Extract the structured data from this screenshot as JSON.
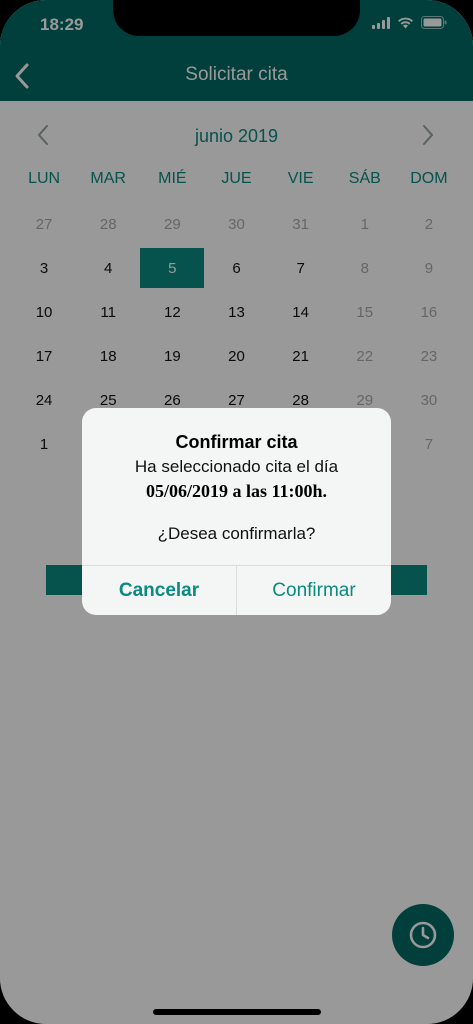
{
  "status_bar": {
    "time": "18:29"
  },
  "header": {
    "title": "Solicitar cita"
  },
  "calendar": {
    "month_label": "junio 2019",
    "weekdays": [
      "LUN",
      "MAR",
      "MIÉ",
      "JUE",
      "VIE",
      "SÁB",
      "DOM"
    ],
    "days": [
      {
        "n": "27",
        "muted": true
      },
      {
        "n": "28",
        "muted": true
      },
      {
        "n": "29",
        "muted": true
      },
      {
        "n": "30",
        "muted": true
      },
      {
        "n": "31",
        "muted": true
      },
      {
        "n": "1",
        "muted": true
      },
      {
        "n": "2",
        "muted": true
      },
      {
        "n": "3"
      },
      {
        "n": "4"
      },
      {
        "n": "5",
        "selected": true
      },
      {
        "n": "6"
      },
      {
        "n": "7"
      },
      {
        "n": "8",
        "muted": true
      },
      {
        "n": "9",
        "muted": true
      },
      {
        "n": "10"
      },
      {
        "n": "11"
      },
      {
        "n": "12"
      },
      {
        "n": "13"
      },
      {
        "n": "14"
      },
      {
        "n": "15",
        "muted": true
      },
      {
        "n": "16",
        "muted": true
      },
      {
        "n": "17"
      },
      {
        "n": "18"
      },
      {
        "n": "19"
      },
      {
        "n": "20"
      },
      {
        "n": "21"
      },
      {
        "n": "22",
        "muted": true
      },
      {
        "n": "23",
        "muted": true
      },
      {
        "n": "24"
      },
      {
        "n": "25"
      },
      {
        "n": "26"
      },
      {
        "n": "27"
      },
      {
        "n": "28"
      },
      {
        "n": "29",
        "muted": true
      },
      {
        "n": "30",
        "muted": true
      },
      {
        "n": "1"
      },
      {
        "n": ""
      },
      {
        "n": ""
      },
      {
        "n": ""
      },
      {
        "n": ""
      },
      {
        "n": ""
      },
      {
        "n": "7",
        "muted": true
      }
    ]
  },
  "dialog": {
    "title": "Confirmar cita",
    "line1": "Ha seleccionado cita el día",
    "line2": "05/06/2019 a las 11:00h.",
    "question": "¿Desea confirmarla?",
    "cancel_label": "Cancelar",
    "confirm_label": "Confirmar"
  },
  "colors": {
    "primary": "#006a64",
    "accent": "#0a8a80"
  },
  "icons": {
    "back": "chevron-left-icon",
    "fab": "clock-icon"
  }
}
